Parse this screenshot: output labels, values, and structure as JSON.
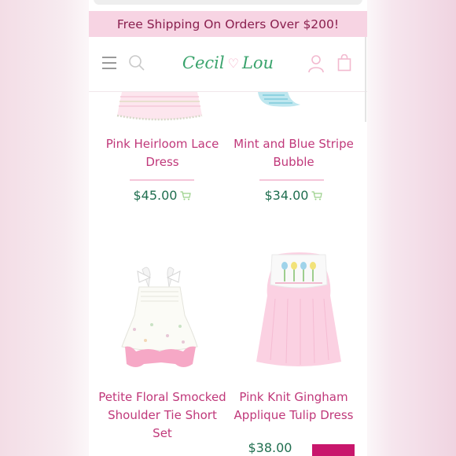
{
  "promo": {
    "text": "Free Shipping On Orders Over $200!"
  },
  "header": {
    "logo_left": "Cecil",
    "logo_right": "Lou"
  },
  "products": [
    {
      "title_line1": "Pink Heirloom Lace",
      "title_line2": "Dress",
      "title_line3": "",
      "price": "$45.00"
    },
    {
      "title_line1": "Mint and Blue Stripe",
      "title_line2": "Bubble",
      "title_line3": "",
      "price": "$34.00"
    },
    {
      "title_line1": "Petite Floral Smocked",
      "title_line2": "Shoulder Tie Short",
      "title_line3": "Set",
      "price": ""
    },
    {
      "title_line1": "Pink Knit Gingham",
      "title_line2": "Applique Tulip Dress",
      "title_line3": "",
      "price": "$38.00"
    }
  ],
  "icons": {
    "menu": "hamburger-icon",
    "search": "search-icon",
    "account": "account-icon",
    "bag": "bag-icon",
    "cart": "cart-icon"
  },
  "colors": {
    "promo_bg": "#f7d4e3",
    "promo_text": "#8a1f4e",
    "title": "#c0387a",
    "price": "#1f6e4f",
    "logo": "#39a36c",
    "accent_pink": "#c8166c"
  }
}
